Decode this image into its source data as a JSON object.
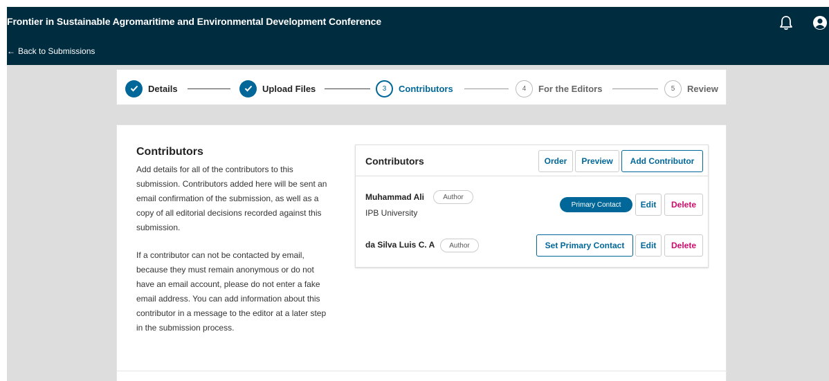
{
  "header": {
    "title": "Frontier in Sustainable Agromaritime and Environmental Development Conference",
    "back_link": "Back to Submissions",
    "back_arrow": "←"
  },
  "steps": [
    {
      "number": "1",
      "label": "Details",
      "state": "done"
    },
    {
      "number": "2",
      "label": "Upload Files",
      "state": "done"
    },
    {
      "number": "3",
      "label": "Contributors",
      "state": "current"
    },
    {
      "number": "4",
      "label": "For the Editors",
      "state": "todo"
    },
    {
      "number": "5",
      "label": "Review",
      "state": "todo"
    }
  ],
  "section": {
    "title": "Contributors",
    "description_1": "Add details for all of the contributors to this submission. Contributors added here will be sent an email confirmation of the submission, as well as a copy of all editorial decisions recorded against this submission.",
    "description_2": "If a contributor can not be contacted by email, because they must remain anonymous or do not have an email account, please do not enter a fake email address. You can add information about this contributor in a message to the editor at a later step in the submission process."
  },
  "grid": {
    "title": "Contributors",
    "order_label": "Order",
    "preview_label": "Preview",
    "add_label": "Add Contributor",
    "rows": [
      {
        "name": "Muhammad Ali",
        "role": "Author",
        "affiliation": "IPB University",
        "primary_label": "Primary Contact",
        "edit_label": "Edit",
        "delete_label": "Delete"
      },
      {
        "name": "da Silva Luis C. A",
        "role": "Author",
        "affiliation": "",
        "set_primary_label": "Set Primary Contact",
        "edit_label": "Edit",
        "delete_label": "Delete"
      }
    ]
  },
  "colors": {
    "header_bg": "#002c40",
    "accent": "#006798",
    "danger": "#d00a6c",
    "page_bg": "#dddddd"
  },
  "icons": {
    "notifications": "bell-icon",
    "user": "user-icon",
    "check": "check-icon"
  }
}
